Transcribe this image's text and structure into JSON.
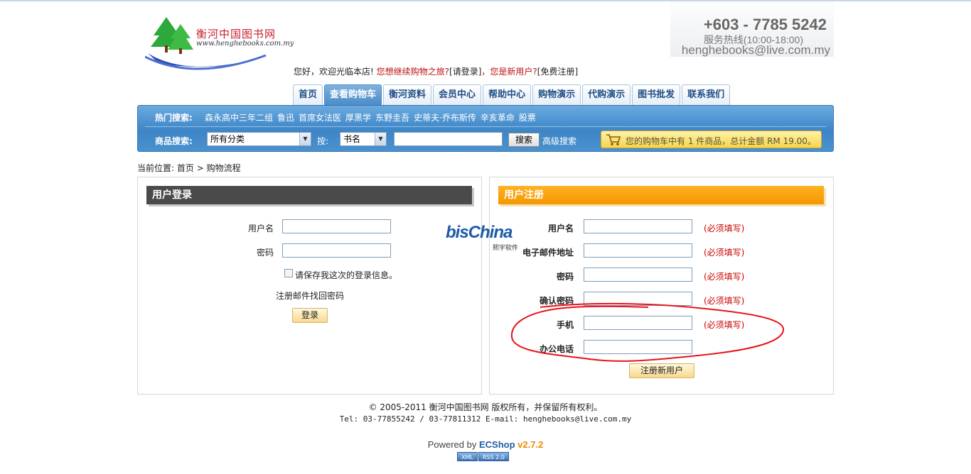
{
  "header": {
    "logo_title": "衡河中国图书网",
    "logo_url": "www.henghebooks.com.my",
    "phone": "+603 - 7785 5242",
    "hotline": "服务热线(10:00-18:00)",
    "email": "henghebooks@live.com.my",
    "welcome": {
      "greeting": "您好，欢迎光临本店!",
      "continue": "您想继续购物之旅?",
      "login_link": "[请登录]",
      "new_user": "，您是新用户?",
      "register_link": "[免费注册]"
    }
  },
  "nav": {
    "tabs": [
      {
        "label": "首页"
      },
      {
        "label": "查看购物车",
        "active": true
      },
      {
        "label": "衡河资料"
      },
      {
        "label": "会员中心"
      },
      {
        "label": "帮助中心"
      },
      {
        "label": "购物演示"
      },
      {
        "label": "代购演示"
      },
      {
        "label": "图书批发"
      },
      {
        "label": "联系我们"
      }
    ]
  },
  "search": {
    "hot_label": "热门搜索:",
    "hot_items": [
      "森永高中三年二组",
      "鲁迅",
      "首席女法医",
      "厚黑学",
      "东野圭吾",
      "史蒂夫·乔布斯传",
      "辛亥革命",
      "股票"
    ],
    "goods_label": "商品搜索:",
    "category_value": "所有分类",
    "by_label": "按:",
    "field_value": "书名",
    "keyword_value": "",
    "search_button": "搜索",
    "advanced_link": "高级搜索",
    "cart_text": "您的购物车中有 1 件商品，总计金额 RM 19.00。"
  },
  "breadcrumb": {
    "prefix": "当前位置:",
    "home": "首页",
    "sep": ">",
    "current": "购物流程"
  },
  "login": {
    "title": "用户登录",
    "username_label": "用户名",
    "password_label": "密码",
    "remember_label": "请保存我这次的登录信息。",
    "forgot_link": "注册邮件找回密码",
    "submit": "登录"
  },
  "register": {
    "title": "用户注册",
    "fields": [
      {
        "label": "用户名",
        "required": "(必须填写)"
      },
      {
        "label": "电子邮件地址",
        "required": "(必须填写)"
      },
      {
        "label": "密码",
        "required": "(必须填写)"
      },
      {
        "label": "确认密码",
        "required": "(必须填写)"
      },
      {
        "label": "手机",
        "required": "(必须填写)"
      },
      {
        "label": "办公电话",
        "required": ""
      }
    ],
    "submit": "注册新用户"
  },
  "watermark": {
    "main": "bisChina",
    "sub": "熙宇软件"
  },
  "footer": {
    "copyright": "© 2005-2011 衡河中国图书网 版权所有，并保留所有权利。",
    "contact": "Tel: 03-77855242 / 03-77811312 E-mail: henghebooks@live.com.my",
    "powered_prefix": "Powered by",
    "powered_brand": "ECShop",
    "powered_version": "v2.7.2",
    "badge_xml": "XML",
    "badge_rss": "RSS 2.0"
  },
  "colors": {
    "nav_active": "#4b8cc8",
    "search_bar": "#3d85c6",
    "login_header": "#4a4a4a",
    "register_header": "#f39800",
    "required_text": "#cc0000",
    "annotation_circle": "#e8131b"
  }
}
